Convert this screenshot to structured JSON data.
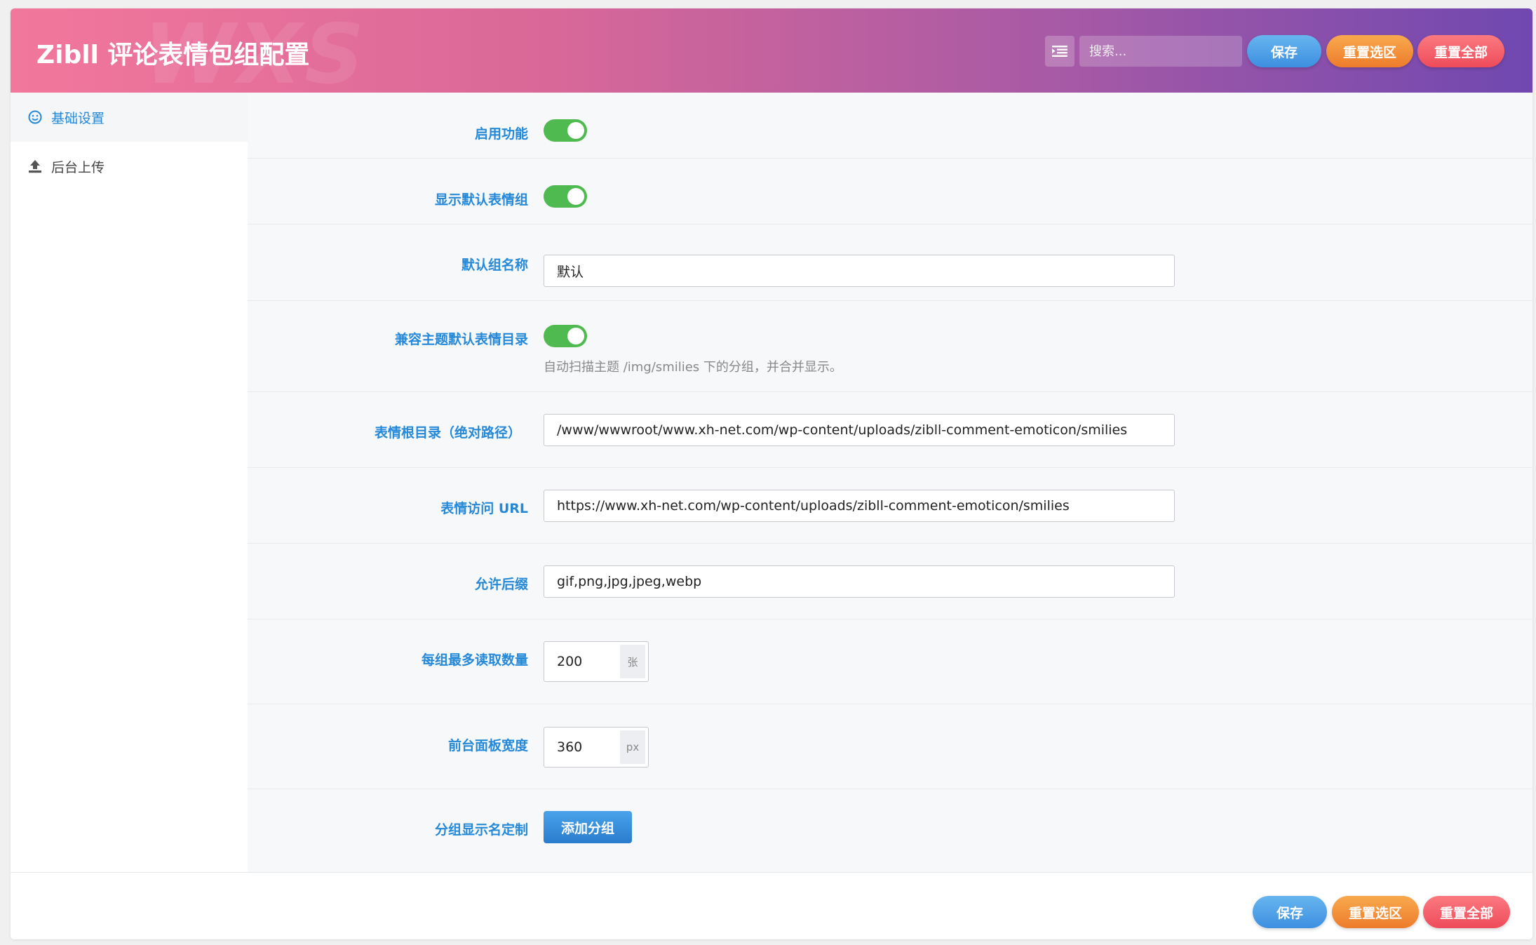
{
  "header": {
    "title": "Zibll 评论表情包组配置",
    "watermark": "WXS",
    "search_placeholder": "搜索...",
    "save_label": "保存",
    "reset_section_label": "重置选区",
    "reset_all_label": "重置全部"
  },
  "sidebar": {
    "items": [
      {
        "label": "基础设置",
        "icon": "smile-icon",
        "active": true
      },
      {
        "label": "后台上传",
        "icon": "upload-icon",
        "active": false
      }
    ]
  },
  "fields": {
    "enable": {
      "label": "启用功能",
      "value": true
    },
    "show_default": {
      "label": "显示默认表情组",
      "value": true
    },
    "default_name": {
      "label": "默认组名称",
      "value": "默认"
    },
    "compat_theme": {
      "label": "兼容主题默认表情目录",
      "value": true,
      "description": "自动扫描主题 /img/smilies 下的分组，并合并显示。"
    },
    "root_dir": {
      "label": "表情根目录（绝对路径）",
      "value": "/www/wwwroot/www.xh-net.com/wp-content/uploads/zibll-comment-emoticon/smilies"
    },
    "url": {
      "label": "表情访问 URL",
      "value": "https://www.xh-net.com/wp-content/uploads/zibll-comment-emoticon/smilies"
    },
    "extensions": {
      "label": "允许后缀",
      "value": "gif,png,jpg,jpeg,webp"
    },
    "max_per_group": {
      "label": "每组最多读取数量",
      "value": "200",
      "unit": "张"
    },
    "panel_width": {
      "label": "前台面板宽度",
      "value": "360",
      "unit": "px"
    },
    "group_names": {
      "label": "分组显示名定制",
      "button_label": "添加分组"
    }
  },
  "footer": {
    "save_label": "保存",
    "reset_section_label": "重置选区",
    "reset_all_label": "重置全部"
  },
  "colors": {
    "accent": "#2589d8",
    "switch_on": "#4fba4f",
    "header_gradient_start": "#f2779c",
    "header_gradient_end": "#7048b0"
  }
}
